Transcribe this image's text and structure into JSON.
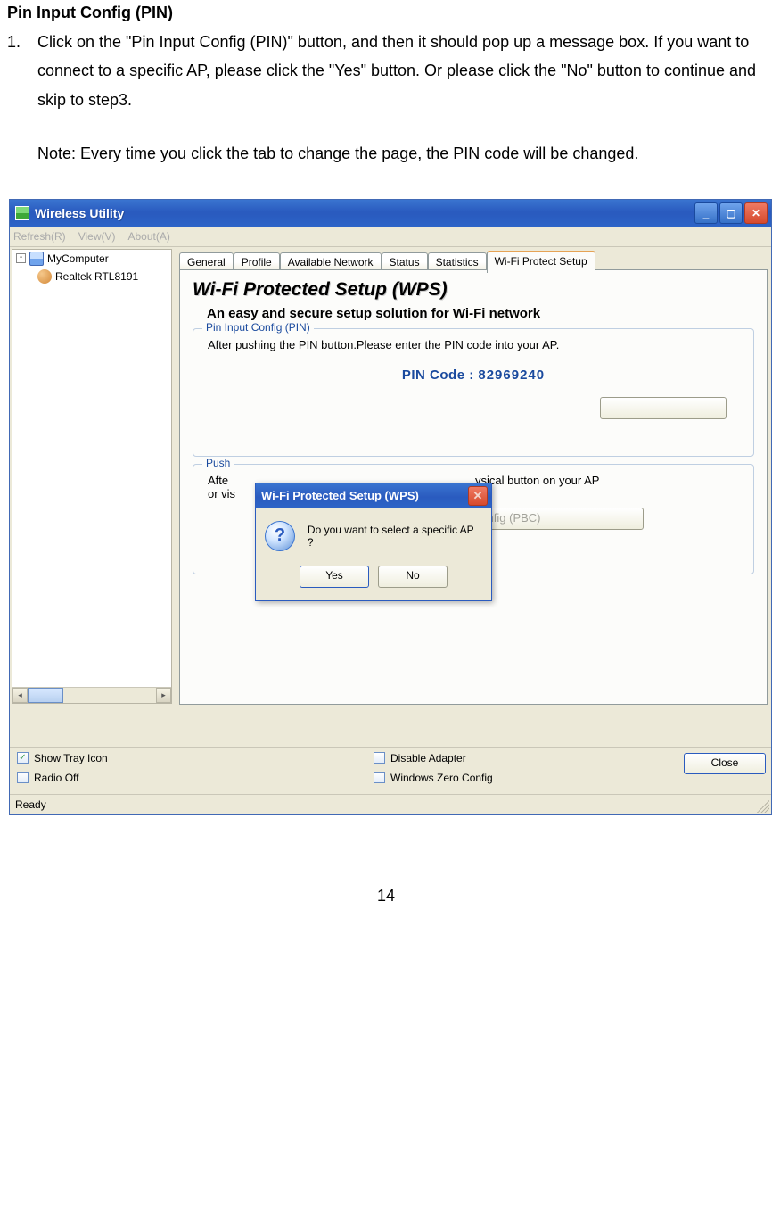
{
  "doc": {
    "heading": "Pin Input Config (PIN)",
    "step_num": "1.",
    "step_text": "Click on the \"Pin Input Config (PIN)\" button, and then it should pop up a message box. If you want to connect to a specific AP, please click the \"Yes\" button. Or please click the \"No\" button to continue and skip to step3.",
    "note": "Note: Every time you click the tab to change the page, the PIN code will be changed.",
    "page_number": "14"
  },
  "app": {
    "title": "Wireless Utility",
    "menu": {
      "refresh": "Refresh(R)",
      "view": "View(V)",
      "about": "About(A)"
    },
    "tree": {
      "root": "MyComputer",
      "node": "Realtek RTL8191"
    },
    "tabs": {
      "general": "General",
      "profile": "Profile",
      "available": "Available Network",
      "status": "Status",
      "statistics": "Statistics",
      "wps": "Wi-Fi Protect Setup"
    },
    "panel": {
      "wps_title": "Wi-Fi Protected Setup (WPS)",
      "wps_sub": "An easy and secure setup solution for Wi-Fi network",
      "pin_legend": "Pin Input Config (PIN)",
      "pin_text": "After pushing the PIN button.Please enter the PIN code into your AP.",
      "pin_label": "PIN Code :  ",
      "pin_value": "82969240",
      "push_legend": "Push",
      "push_text1": "Afte",
      "push_text2": "or vis",
      "push_text_trail": "ysical button on your AP",
      "pbc_btn": "Push Button Config (PBC)"
    },
    "dialog": {
      "title": "Wi-Fi Protected Setup (WPS)",
      "msg": "Do you want to select a specific AP ?",
      "yes": "Yes",
      "no": "No"
    },
    "bottom": {
      "show_tray": "Show Tray Icon",
      "radio_off": "Radio Off",
      "disable": "Disable Adapter",
      "zero": "Windows Zero Config",
      "close": "Close"
    },
    "status_text": "Ready"
  }
}
